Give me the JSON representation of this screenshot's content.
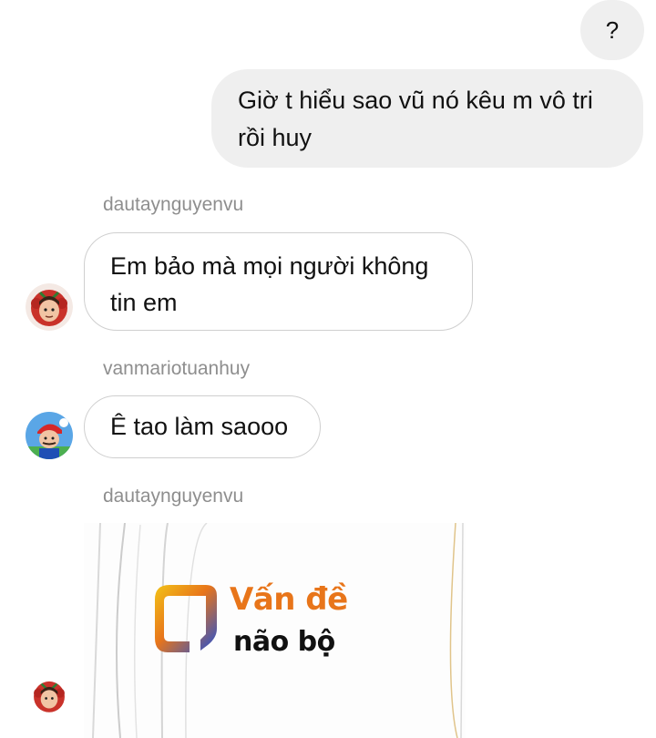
{
  "messages": {
    "outgoing_1": "?",
    "outgoing_2": "Giờ t hiểu sao vũ nó kêu m vô tri rồi huy",
    "sender_1": "dautaynguyenvu",
    "incoming_1": "Em bảo mà mọi người không tin em",
    "sender_2": "vanmariotuanhuy",
    "incoming_2": "Ê tao làm saooo",
    "sender_3": "dautaynguyenvu",
    "image_line_1": "Vấn đề",
    "image_line_2": "não bộ"
  },
  "colors": {
    "outgoing_bg": "#efefef",
    "incoming_border": "#cfcfcf",
    "sender_gray": "#8e8e8e",
    "image_accent_orange": "#e8751a",
    "logo_blue": "#1f4fd6",
    "logo_yellow": "#f2c318"
  },
  "icons": {
    "avatar_1": "tomato-character-avatar",
    "avatar_2": "mario-character-avatar",
    "avatar_3": "tomato-character-avatar"
  }
}
